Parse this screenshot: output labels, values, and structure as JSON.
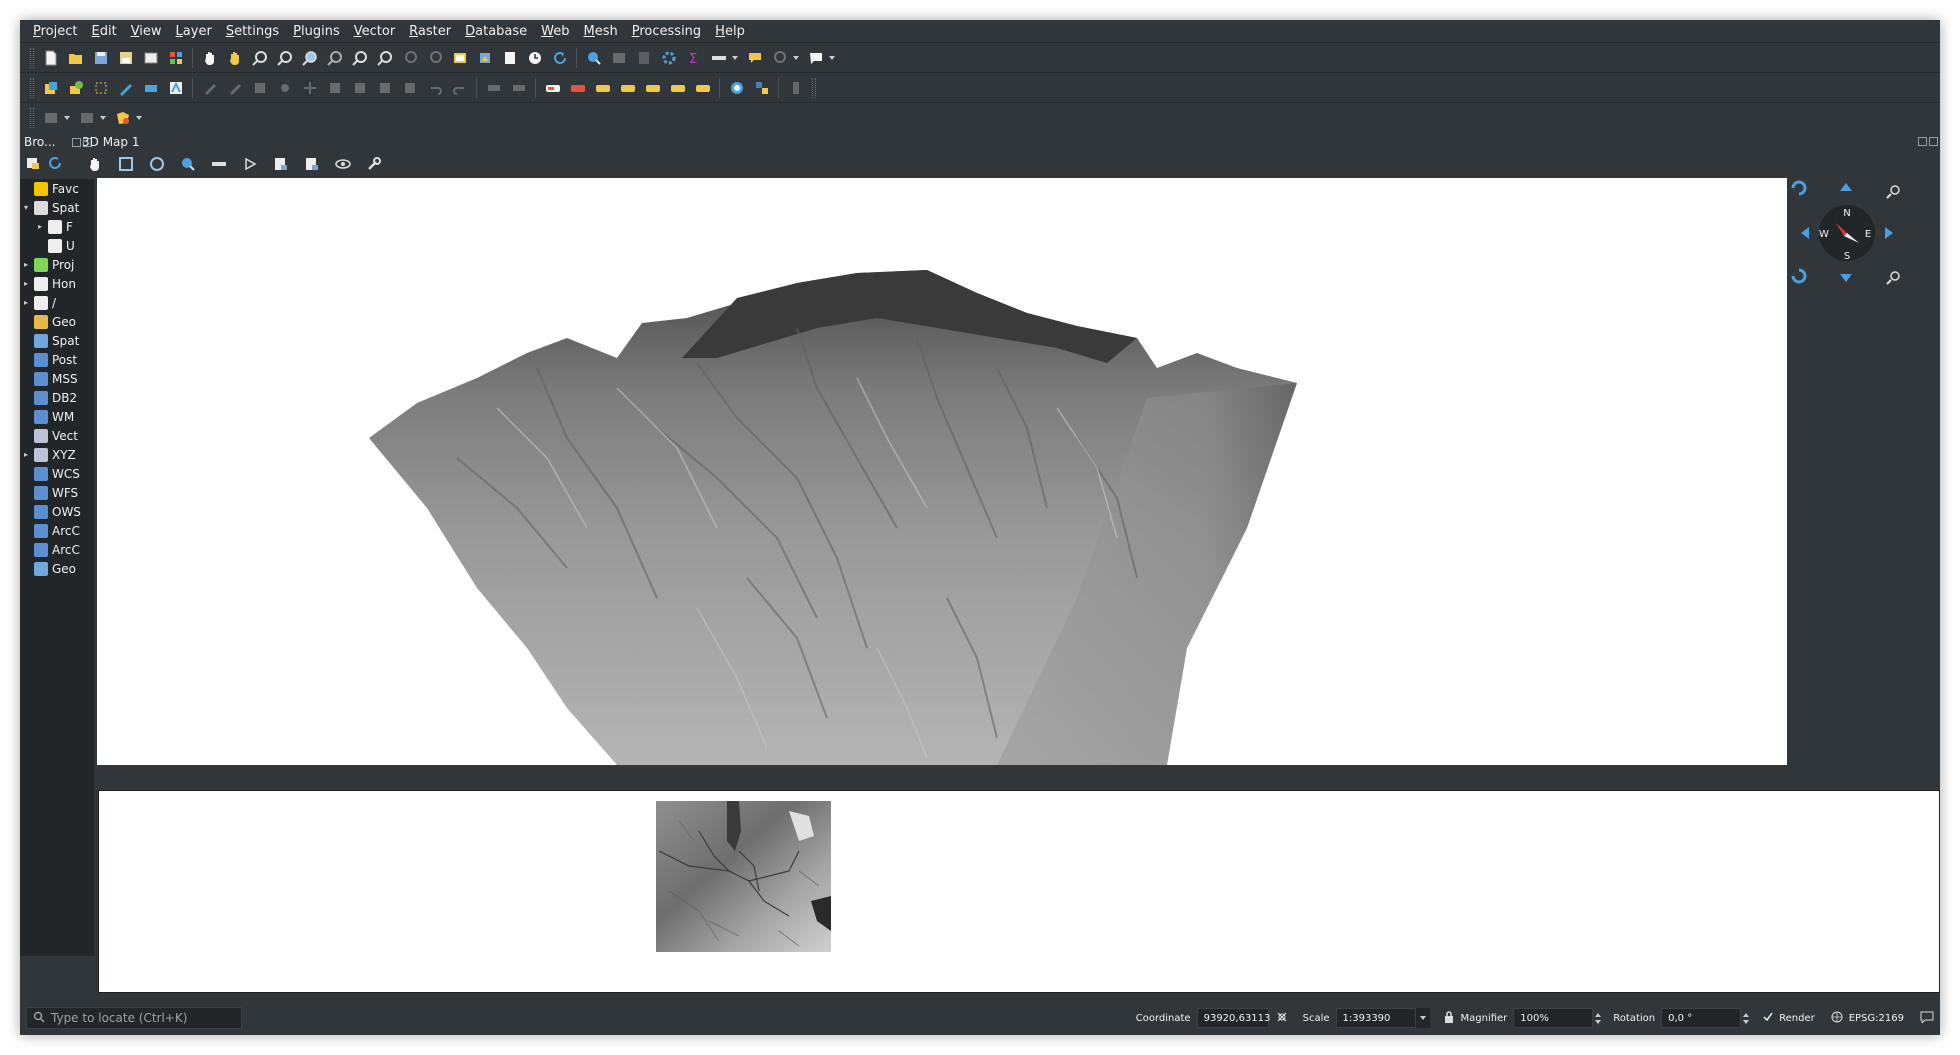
{
  "menu": [
    "Project",
    "Edit",
    "View",
    "Layer",
    "Settings",
    "Plugins",
    "Vector",
    "Raster",
    "Database",
    "Web",
    "Mesh",
    "Processing",
    "Help"
  ],
  "browser": {
    "title": "Bro...",
    "items": [
      {
        "label": "Favc",
        "icon": "star-icon",
        "color": "#f5c400",
        "arrow": ""
      },
      {
        "label": "Spat",
        "icon": "spatial-bookmarks-icon",
        "color": "#dcdcdc",
        "arrow": "▾"
      },
      {
        "label": "F",
        "icon": "folder-icon",
        "color": "#eeeeee",
        "arrow": "▸",
        "indent": true
      },
      {
        "label": "U",
        "icon": "folder-icon",
        "color": "#eeeeee",
        "arrow": "",
        "indent": true
      },
      {
        "label": "Proj",
        "icon": "project-home-icon",
        "color": "#7fd45a",
        "arrow": "▸"
      },
      {
        "label": "Hon",
        "icon": "home-icon",
        "color": "#eeeeee",
        "arrow": "▸"
      },
      {
        "label": "/",
        "icon": "folder-icon",
        "color": "#eeeeee",
        "arrow": "▸"
      },
      {
        "label": "Geo",
        "icon": "geopackage-icon",
        "color": "#e8b84a",
        "arrow": ""
      },
      {
        "label": "Spat",
        "icon": "spatialite-icon",
        "color": "#6fa8dc",
        "arrow": ""
      },
      {
        "label": "Post",
        "icon": "postgis-icon",
        "color": "#5b8fd1",
        "arrow": ""
      },
      {
        "label": "MSS",
        "icon": "mssql-icon",
        "color": "#5b8fd1",
        "arrow": ""
      },
      {
        "label": "DB2",
        "icon": "db2-icon",
        "color": "#5b8fd1",
        "arrow": ""
      },
      {
        "label": "WM",
        "icon": "wms-icon",
        "color": "#5b8fd1",
        "arrow": ""
      },
      {
        "label": "Vect",
        "icon": "vector-tiles-icon",
        "color": "#bcc3d6",
        "arrow": ""
      },
      {
        "label": "XYZ",
        "icon": "xyz-tiles-icon",
        "color": "#bcc3d6",
        "arrow": "▸"
      },
      {
        "label": "WCS",
        "icon": "wcs-icon",
        "color": "#5b8fd1",
        "arrow": ""
      },
      {
        "label": "WFS",
        "icon": "wfs-icon",
        "color": "#5b8fd1",
        "arrow": ""
      },
      {
        "label": "OWS",
        "icon": "ows-icon",
        "color": "#5b8fd1",
        "arrow": ""
      },
      {
        "label": "ArcC",
        "icon": "arcgis-map-icon",
        "color": "#5b8fd1",
        "arrow": ""
      },
      {
        "label": "ArcC",
        "icon": "arcgis-feature-icon",
        "color": "#5b8fd1",
        "arrow": ""
      },
      {
        "label": "Geo",
        "icon": "geonode-icon",
        "color": "#6fa8dc",
        "arrow": ""
      }
    ]
  },
  "map3d": {
    "title": "3D Map 1",
    "compass": {
      "n": "N",
      "s": "S",
      "e": "E",
      "w": "W"
    }
  },
  "status": {
    "locator_placeholder": "Type to locate (Ctrl+K)",
    "coordinate_label": "Coordinate",
    "coordinate_value": "93920,63113",
    "scale_label": "Scale",
    "scale_value": "1:393390",
    "magnifier_label": "Magnifier",
    "magnifier_value": "100%",
    "rotation_label": "Rotation",
    "rotation_value": "0,0 °",
    "render_label": "Render",
    "crs_label": "EPSG:2169"
  }
}
